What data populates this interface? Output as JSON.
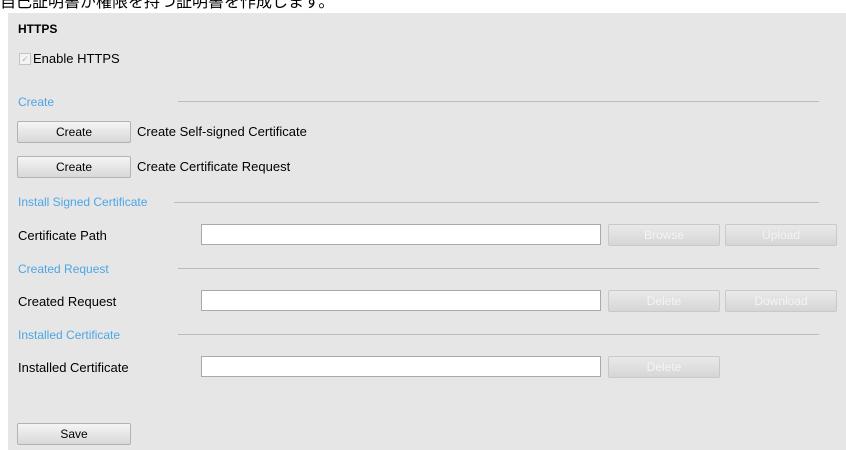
{
  "caption": "自己証明書が権限を持つ証明書を作成します。",
  "https": {
    "title": "HTTPS",
    "enable_label": "Enable  HTTPS",
    "enable_checked": true,
    "check_glyph": "✓"
  },
  "create": {
    "section_label": "Create",
    "self_signed_button": "Create",
    "self_signed_label": "Create Self-signed Certificate",
    "request_button": "Create",
    "request_label": "Create Certificate Request"
  },
  "install": {
    "section_label": "Install Signed Certificate",
    "path_label": "Certificate Path",
    "path_value": "",
    "browse_button": "Browse",
    "upload_button": "Upload"
  },
  "created_request": {
    "section_label": "Created Request",
    "label": "Created Request",
    "value": "",
    "delete_button": "Delete",
    "download_button": "Download"
  },
  "installed": {
    "section_label": "Installed Certificate",
    "label": "Installed Certificate",
    "value": "",
    "delete_button": "Delete"
  },
  "save_button": "Save",
  "colors": {
    "section_text": "#4da6e6",
    "panel_bg": "#e6e6e6",
    "disabled_text": "#f4f4f4"
  }
}
